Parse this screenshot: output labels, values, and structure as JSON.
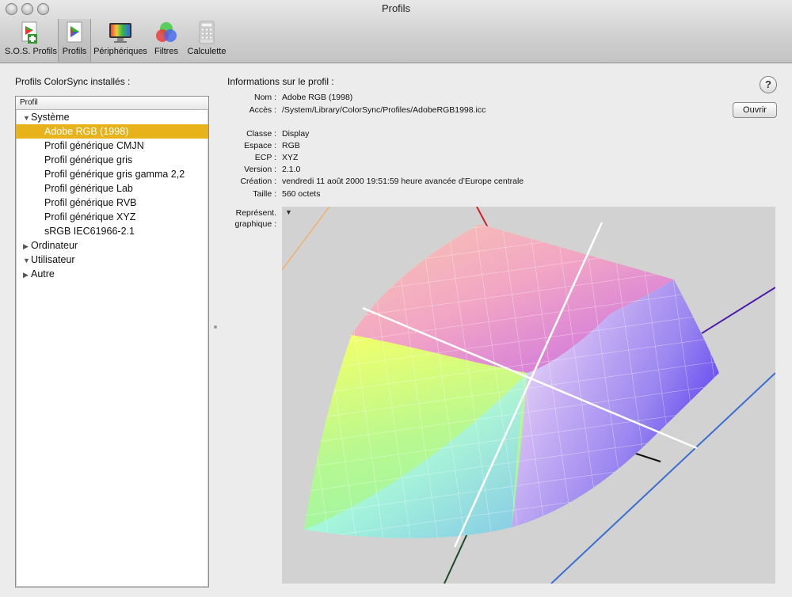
{
  "window": {
    "title": "Profils"
  },
  "toolbar": {
    "items": [
      {
        "label": "S.O.S. Profils",
        "icon": "first-aid-profile-icon"
      },
      {
        "label": "Profils",
        "icon": "profile-document-icon",
        "selected": true
      },
      {
        "label": "Périphériques",
        "icon": "monitor-icon"
      },
      {
        "label": "Filtres",
        "icon": "color-filter-circles-icon"
      },
      {
        "label": "Calculette",
        "icon": "calculator-icon"
      }
    ]
  },
  "left_panel": {
    "title": "Profils ColorSync installés :",
    "column_header": "Profil",
    "tree": [
      {
        "label": "Système",
        "level": 0,
        "expanded": true
      },
      {
        "label": "Adobe RGB (1998)",
        "level": 1,
        "selected": true
      },
      {
        "label": "Profil générique CMJN",
        "level": 1
      },
      {
        "label": "Profil générique gris",
        "level": 1
      },
      {
        "label": "Profil générique gris gamma 2,2",
        "level": 1
      },
      {
        "label": "Profil générique Lab",
        "level": 1
      },
      {
        "label": "Profil générique RVB",
        "level": 1
      },
      {
        "label": "Profil générique XYZ",
        "level": 1
      },
      {
        "label": "sRGB IEC61966-2.1",
        "level": 1
      },
      {
        "label": "Ordinateur",
        "level": 0,
        "expanded": false
      },
      {
        "label": "Utilisateur",
        "level": 0,
        "expanded": true
      },
      {
        "label": "Autre",
        "level": 0,
        "expanded": false
      }
    ]
  },
  "right_panel": {
    "title": "Informations sur le profil :",
    "open_button": "Ouvrir",
    "help": "?",
    "name_label": "Nom :",
    "name_value": "Adobe RGB (1998)",
    "access_label": "Accès :",
    "access_value": "/System/Library/ColorSync/Profiles/AdobeRGB1998.icc",
    "class_label": "Classe :",
    "class_value": "Display",
    "space_label": "Espace :",
    "space_value": "RGB",
    "pcs_label": "ECP :",
    "pcs_value": "XYZ",
    "version_label": "Version :",
    "version_value": "2.1.0",
    "creation_label": "Création :",
    "creation_value": "vendredi 11 août 2000 19:51:59 heure avancée d’Europe centrale",
    "size_label": "Taille :",
    "size_value": "560 octets",
    "graph_label_1": "Représent.",
    "graph_label_2": "graphique :",
    "graph_menu_glyph": "▼"
  },
  "colors": {
    "selection": "#e8b21a",
    "background": "#ececec",
    "graph_bg": "#d2d2d2"
  }
}
